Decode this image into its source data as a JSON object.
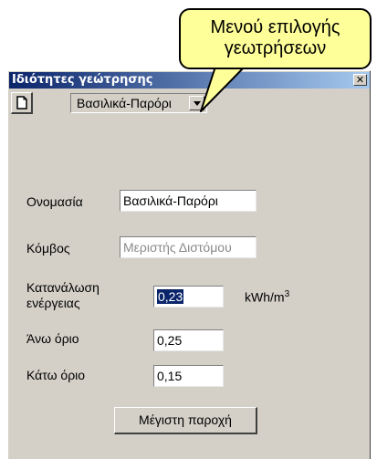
{
  "callout": {
    "line1": "Μενού επιλογής",
    "line2": "γεωτρήσεων"
  },
  "window": {
    "title": "Ιδιότητες γεώτρησης",
    "close_glyph": "✕"
  },
  "toolbar": {
    "new_icon": "new-document-icon",
    "selected_borehole": "Βασιλικά-Παρόρι"
  },
  "form": {
    "name_label": "Ονομασία",
    "name_value": "Βασιλικά-Παρόρι",
    "node_label": "Κόμβος",
    "node_value": "Μεριστής Διστόμου",
    "energy_label_line1": "Κατανάλωση",
    "energy_label_line2": "ενέργειας",
    "energy_value": "0,23",
    "energy_unit": "kWh/m",
    "energy_unit_exp": "3",
    "upper_label": "Άνω όριο",
    "upper_value": "0,25",
    "lower_label": "Κάτω όριο",
    "lower_value": "0,15",
    "max_flow_button": "Μέγιστη παροχή"
  },
  "colors": {
    "titlebar_start": "#0a246a",
    "titlebar_end": "#a6caf0",
    "dialog_bg": "#d4d0c8",
    "callout_bg": "#ffff99"
  }
}
